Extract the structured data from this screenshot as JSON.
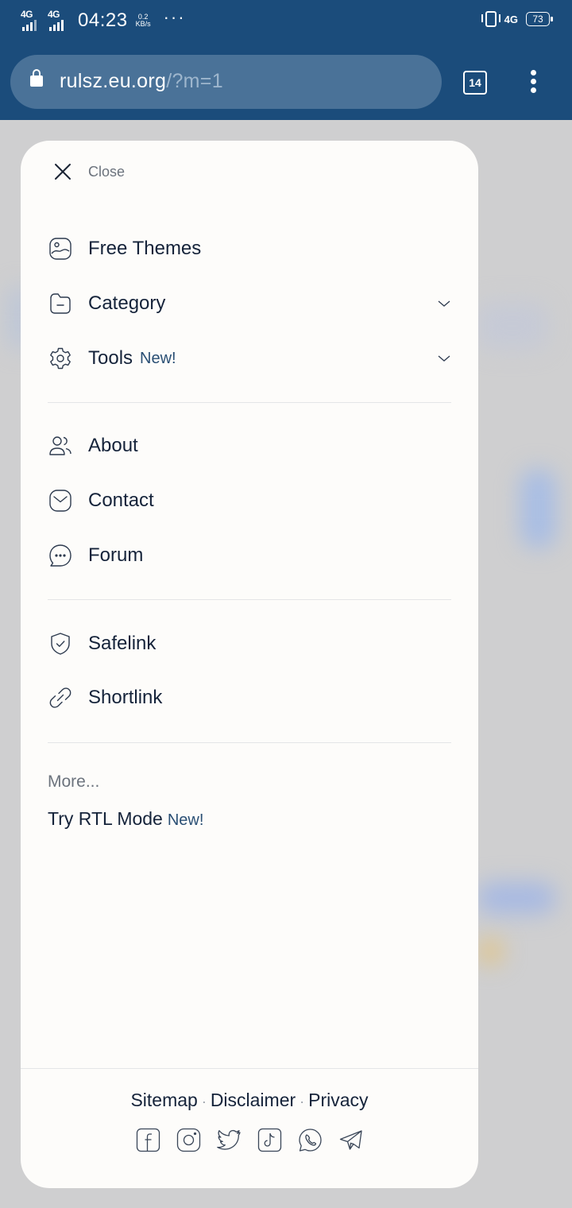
{
  "status_bar": {
    "sim1": "4G",
    "sim2": "4G",
    "time": "04:23",
    "speed_value": "0.2",
    "speed_unit": "KB/s",
    "dots": "···",
    "right_network": "4G",
    "battery": "73"
  },
  "browser": {
    "url_host": "rulsz.eu.org",
    "url_path": "/?m=1",
    "tab_count": "14"
  },
  "drawer": {
    "close_label": "Close",
    "primary_items": [
      {
        "label": "Free Themes",
        "icon": "image-icon"
      },
      {
        "label": "Category",
        "icon": "folder-icon",
        "expandable": true
      },
      {
        "label": "Tools",
        "badge": "New!",
        "icon": "gear-icon",
        "expandable": true
      }
    ],
    "secondary_items": [
      {
        "label": "About",
        "icon": "users-icon"
      },
      {
        "label": "Contact",
        "icon": "mail-icon"
      },
      {
        "label": "Forum",
        "icon": "chat-bubble-icon"
      }
    ],
    "tertiary_items": [
      {
        "label": "Safelink",
        "icon": "shield-check-icon"
      },
      {
        "label": "Shortlink",
        "icon": "link-icon"
      }
    ],
    "more_label": "More...",
    "rtl_label": "Try RTL Mode",
    "rtl_badge": "New!"
  },
  "footer": {
    "links": [
      "Sitemap",
      "Disclaimer",
      "Privacy"
    ],
    "separator": "·",
    "social_icons": [
      "facebook-icon",
      "instagram-icon",
      "twitter-icon",
      "tiktok-icon",
      "whatsapp-icon",
      "telegram-icon"
    ]
  },
  "colors": {
    "chrome_blue": "#1b4c7b",
    "url_bar": "#4a7298",
    "text_dark": "#15233a",
    "badge_blue": "#2a4f74",
    "muted": "#6c737d"
  }
}
